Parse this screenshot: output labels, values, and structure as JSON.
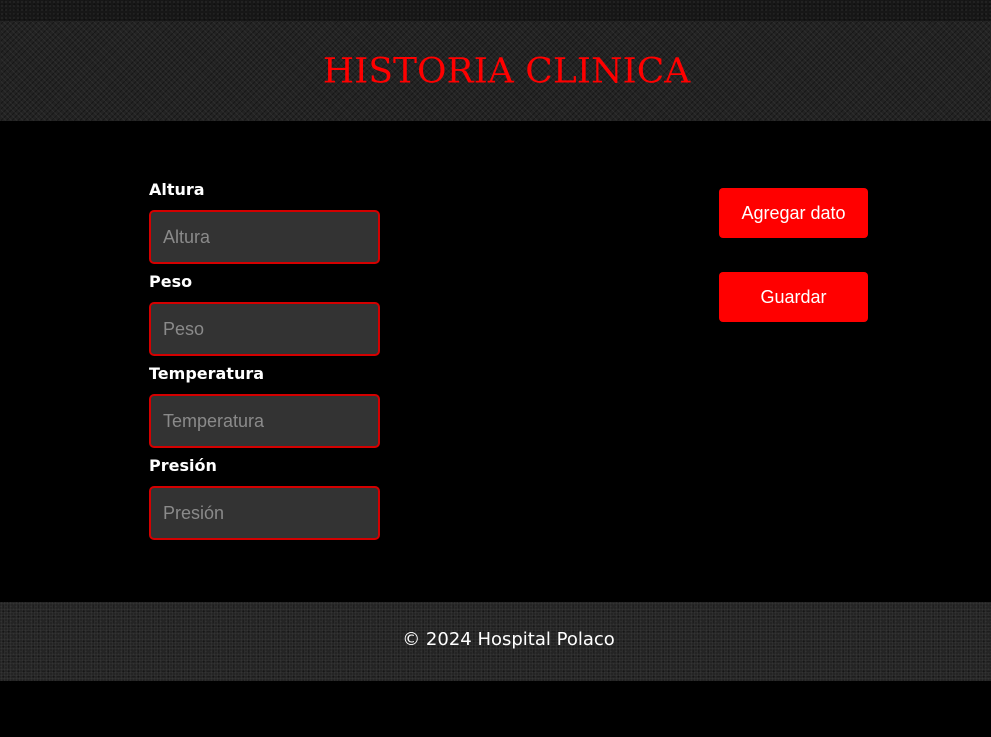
{
  "header": {
    "title": "HISTORIA CLINICA"
  },
  "form": {
    "fields": [
      {
        "label": "Altura",
        "placeholder": "Altura",
        "value": ""
      },
      {
        "label": "Peso",
        "placeholder": "Peso",
        "value": ""
      },
      {
        "label": "Temperatura",
        "placeholder": "Temperatura",
        "value": ""
      },
      {
        "label": "Presión",
        "placeholder": "Presión",
        "value": ""
      }
    ]
  },
  "actions": {
    "add_label": "Agregar dato",
    "save_label": "Guardar"
  },
  "footer": {
    "text": "© 2024 Hospital Polaco"
  },
  "colors": {
    "accent": "#ff0000",
    "input_border": "#d40000",
    "input_bg": "#333333",
    "page_bg": "#000000"
  }
}
